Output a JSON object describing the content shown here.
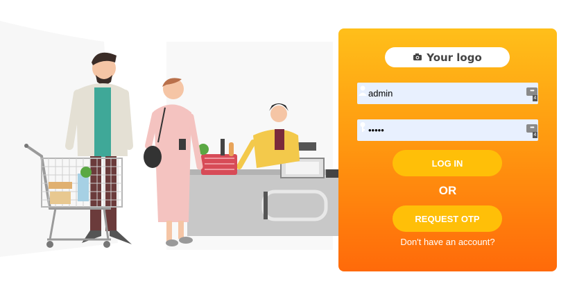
{
  "logo": {
    "text": "Your logo",
    "icon": "camera-icon"
  },
  "form": {
    "username_value": "admin",
    "password_value": "•••••",
    "password_manager_badge": "4",
    "login_label": "LOG IN",
    "or_label": "OR",
    "otp_label": "REQUEST OTP",
    "signup_link": "Don't have an account?"
  },
  "colors": {
    "card_gradient_top": "#ffbf1a",
    "card_gradient_bottom": "#ff6a0a",
    "button": "#ffbf08",
    "field_background": "#e8f0fe"
  }
}
